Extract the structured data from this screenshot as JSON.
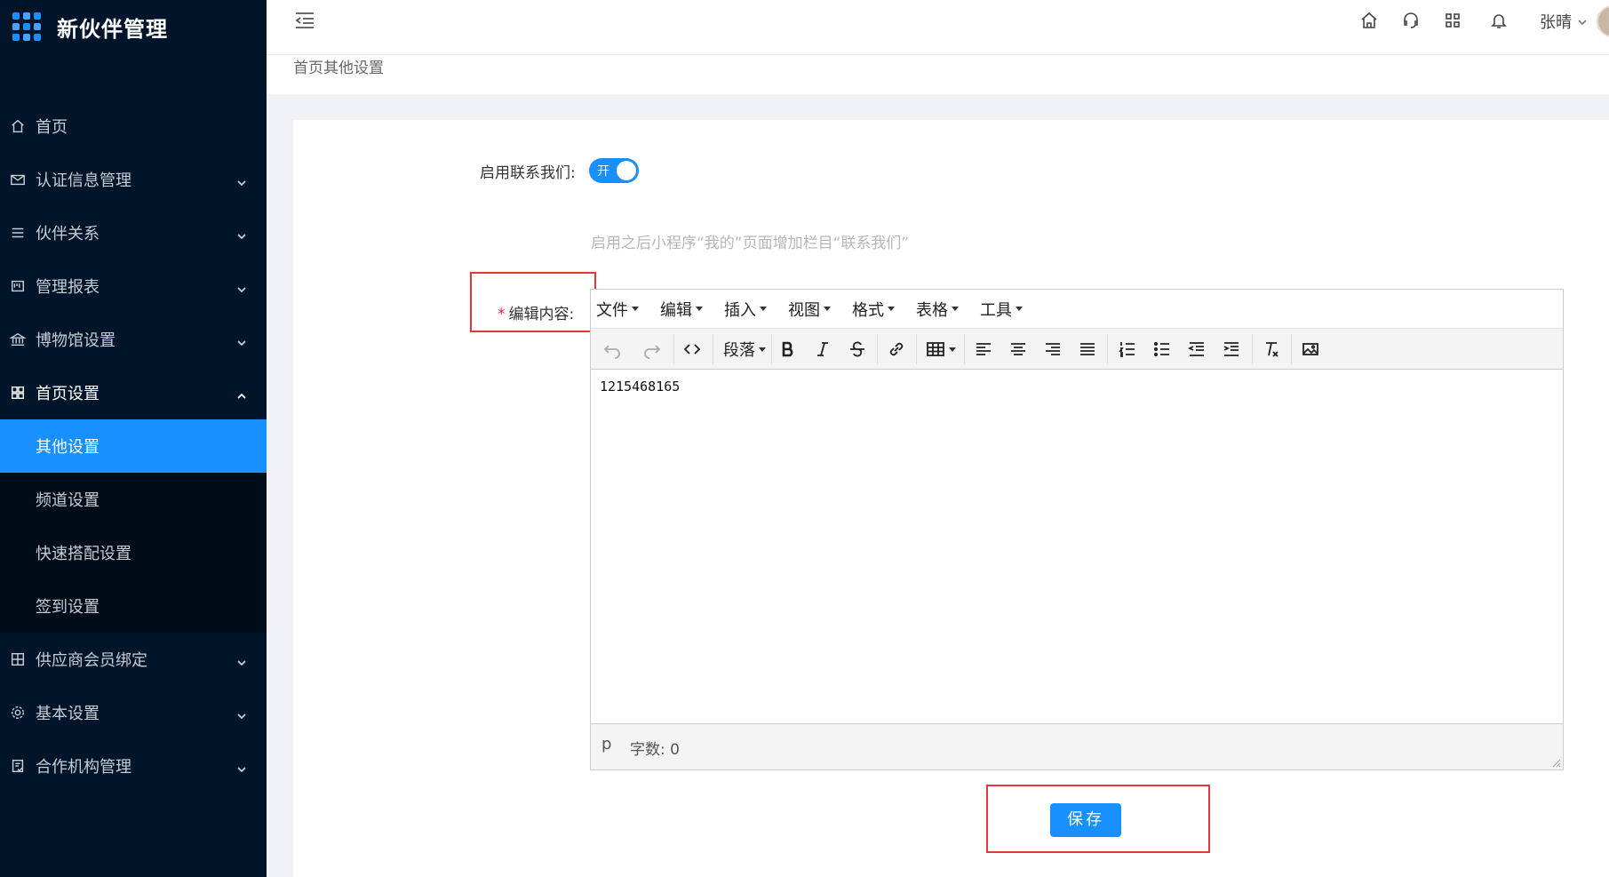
{
  "app": {
    "title": "新伙伴管理"
  },
  "sidebar": {
    "items": [
      {
        "label": "首页",
        "icon": "home-icon"
      },
      {
        "label": "认证信息管理",
        "icon": "mail-icon"
      },
      {
        "label": "伙伴关系",
        "icon": "list-icon"
      },
      {
        "label": "管理报表",
        "icon": "report-icon"
      },
      {
        "label": "博物馆设置",
        "icon": "bank-icon"
      },
      {
        "label": "首页设置",
        "icon": "appstore-icon"
      },
      {
        "label": "供应商会员绑定",
        "icon": "link-icon"
      },
      {
        "label": "基本设置",
        "icon": "gear-icon"
      },
      {
        "label": "合作机构管理",
        "icon": "audit-icon"
      }
    ],
    "submenu": [
      {
        "label": "其他设置",
        "active": true
      },
      {
        "label": "频道设置"
      },
      {
        "label": "快速搭配设置"
      },
      {
        "label": "签到设置"
      }
    ]
  },
  "header": {
    "user": "张晴"
  },
  "breadcrumb": "首页其他设置",
  "form": {
    "contact_label": "启用联系我们:",
    "switch_on_text": "开",
    "switch_on": true,
    "hint": "启用之后小程序“我的”页面增加栏目“联系我们”",
    "required_mark": "*",
    "content_label": "编辑内容:",
    "save_label": "保存"
  },
  "editor": {
    "menus": [
      "文件",
      "编辑",
      "插入",
      "视图",
      "格式",
      "表格",
      "工具"
    ],
    "block_format": "段落",
    "content": "1215468165",
    "status_path": "p",
    "word_count": "字数: 0"
  },
  "colors": {
    "accent": "#1890ff",
    "sidebar_bg": "#001529",
    "highlight_box": "#e8353a"
  }
}
